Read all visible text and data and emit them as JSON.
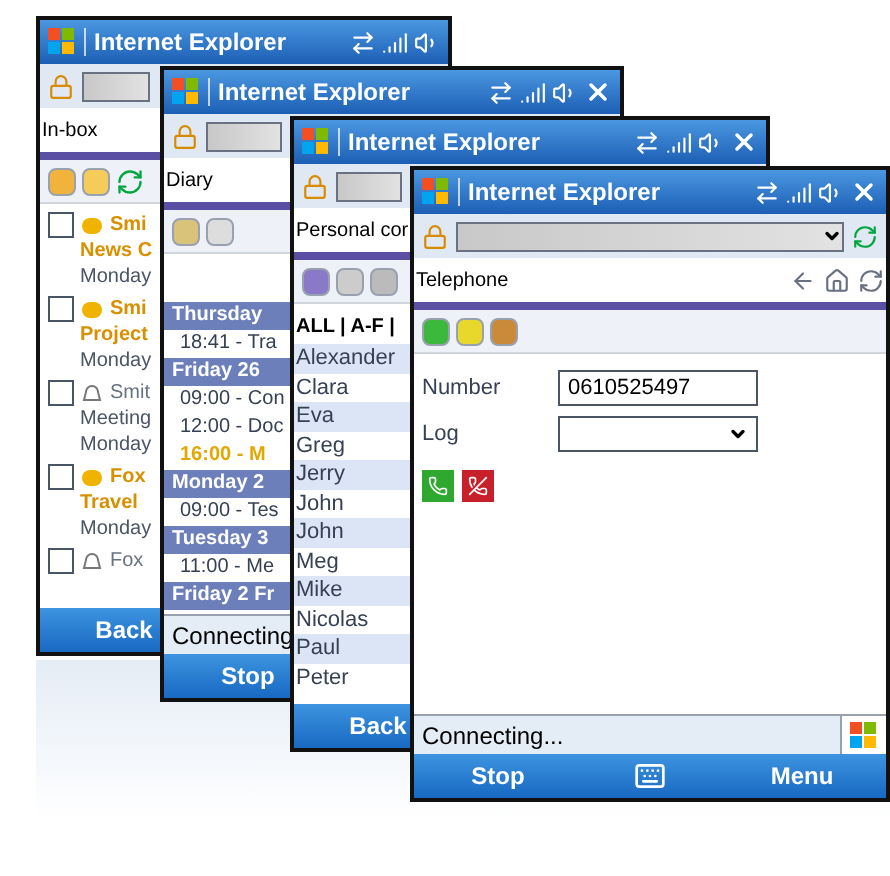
{
  "windows": [
    {
      "kind": "inbox",
      "title": "Internet Explorer",
      "close_button": false,
      "page_title": "In-box",
      "messages": [
        {
          "kind": "mail",
          "checked": false,
          "unread": true,
          "sender": "Smi",
          "subject": "News C",
          "date": "Monday"
        },
        {
          "kind": "mail",
          "checked": false,
          "unread": true,
          "sender": "Smi",
          "subject": "Project",
          "date": "Monday"
        },
        {
          "kind": "meeting",
          "checked": false,
          "unread": false,
          "sender": "Smit",
          "subject": "Meeting",
          "date": "Monday"
        },
        {
          "kind": "mail",
          "checked": false,
          "unread": true,
          "sender": "Fox",
          "subject": "Travel",
          "date": "Monday"
        },
        {
          "kind": "meeting",
          "checked": false,
          "unread": false,
          "sender": "Fox"
        }
      ],
      "softkeys": [
        {
          "label": "Back"
        }
      ]
    },
    {
      "kind": "diary",
      "title": "Internet Explorer",
      "close_button": true,
      "page_title": "Diary",
      "entries": [
        {
          "kind": "day",
          "text": "Thursday"
        },
        {
          "kind": "event",
          "text": "18:41 - Tra",
          "highlighted": false
        },
        {
          "kind": "day",
          "text": "Friday 26"
        },
        {
          "kind": "event",
          "text": "09:00 - Con",
          "highlighted": false
        },
        {
          "kind": "event",
          "text": "12:00 - Doc",
          "highlighted": false
        },
        {
          "kind": "event",
          "text": "16:00 - M",
          "highlighted": true
        },
        {
          "kind": "day",
          "text": "Monday 2"
        },
        {
          "kind": "event",
          "text": "09:00 - Tes",
          "highlighted": false
        },
        {
          "kind": "day",
          "text": "Tuesday 3"
        },
        {
          "kind": "event",
          "text": "11:00 - Me",
          "highlighted": false
        },
        {
          "kind": "day",
          "text": "Friday 2 Fr"
        }
      ],
      "status": "Connecting",
      "softkeys": [
        {
          "label": "Stop"
        }
      ]
    },
    {
      "kind": "contacts",
      "title": "Internet Explorer",
      "close_button": true,
      "page_title": "Personal cor",
      "filter": "ALL | A-F |",
      "contacts": [
        "Alexander",
        "Clara",
        "Eva",
        "Greg",
        "Jerry",
        "John",
        "John",
        "Meg",
        "Mike",
        "Nicolas",
        "Paul",
        "Peter"
      ],
      "softkeys": [
        {
          "label": "Back"
        }
      ]
    },
    {
      "kind": "telephone",
      "title": "Internet Explorer",
      "close_button": true,
      "page_title": "Telephone",
      "fields": [
        {
          "kind": "text",
          "label": "Number",
          "value": "0610525497"
        },
        {
          "kind": "select",
          "label": "Log"
        }
      ],
      "status": "Connecting...",
      "softkeys": [
        {
          "label": "Stop"
        },
        {
          "label": "Menu"
        }
      ]
    }
  ]
}
